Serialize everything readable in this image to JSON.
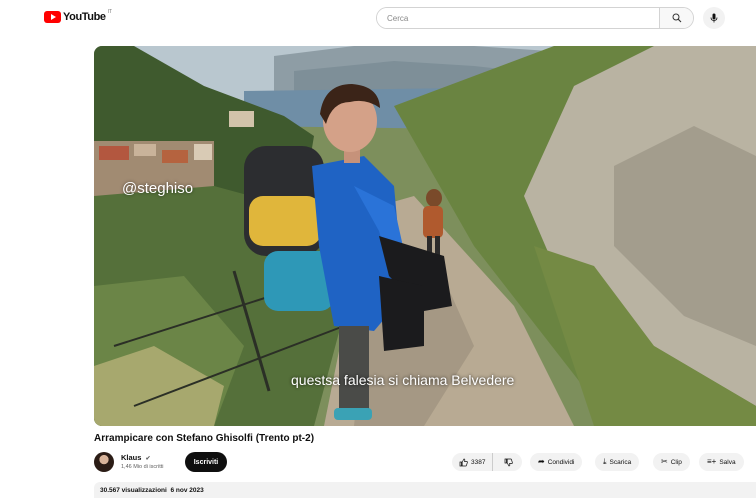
{
  "header": {
    "logo_text": "YouTube",
    "logo_sup": "IT",
    "search_placeholder": "Cerca"
  },
  "video": {
    "watermark": "@steghiso",
    "subtitle": "questsa falesia si chiama Belvedere"
  },
  "title": "Arrampicare con Stefano Ghisolfi (Trento pt-2)",
  "channel": {
    "name": "Klaus",
    "verified_icon": "check-circle-icon",
    "subscribers": "1,46 Mio di iscritti",
    "subscribe_label": "Iscriviti"
  },
  "actions": {
    "like_count": "3387",
    "share_label": "Condividi",
    "download_label": "Scarica",
    "clip_label": "Clip",
    "save_label": "Salva"
  },
  "description": {
    "views": "30.567 visualizzazioni",
    "date": "6 nov 2023"
  },
  "colors": {
    "brand_red": "#ff0000",
    "subscribe_bg": "#0f0f0f",
    "pill_bg": "#f2f2f2"
  }
}
